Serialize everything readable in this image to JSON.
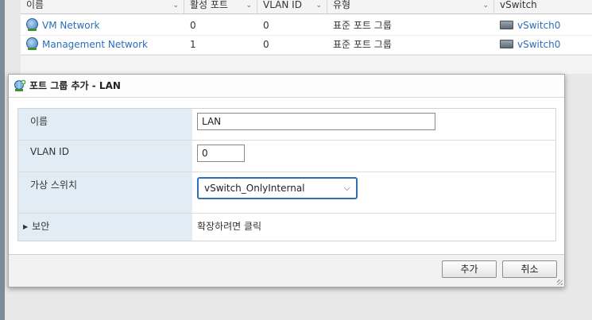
{
  "grid": {
    "columns": [
      {
        "label": "이름"
      },
      {
        "label": "활성 포트"
      },
      {
        "label": "VLAN ID"
      },
      {
        "label": "유형"
      },
      {
        "label": "vSwitch"
      }
    ],
    "rows": [
      {
        "name": "VM Network",
        "active_ports": "0",
        "vlan_id": "0",
        "type": "표준 포트 그룹",
        "vswitch": "vSwitch0"
      },
      {
        "name": "Management Network",
        "active_ports": "1",
        "vlan_id": "0",
        "type": "표준 포트 그룹",
        "vswitch": "vSwitch0"
      }
    ]
  },
  "dialog": {
    "title": "포트 그룹 추가 - LAN",
    "fields": {
      "name_label": "이름",
      "name_value": "LAN",
      "vlan_label": "VLAN ID",
      "vlan_value": "0",
      "vswitch_label": "가상 스위치",
      "vswitch_value": "vSwitch_OnlyInternal",
      "security_label": "보안",
      "security_value": "확장하려면 클릭"
    },
    "buttons": {
      "add": "추가",
      "cancel": "취소"
    }
  },
  "icons": {
    "network": "network-globe-icon",
    "vswitch": "vswitch-icon",
    "add_portgroup": "add-portgroup-icon"
  },
  "colors": {
    "link": "#2a6ebb",
    "label_bg": "#e1ecf4",
    "focus_border": "#2f6fb5"
  }
}
